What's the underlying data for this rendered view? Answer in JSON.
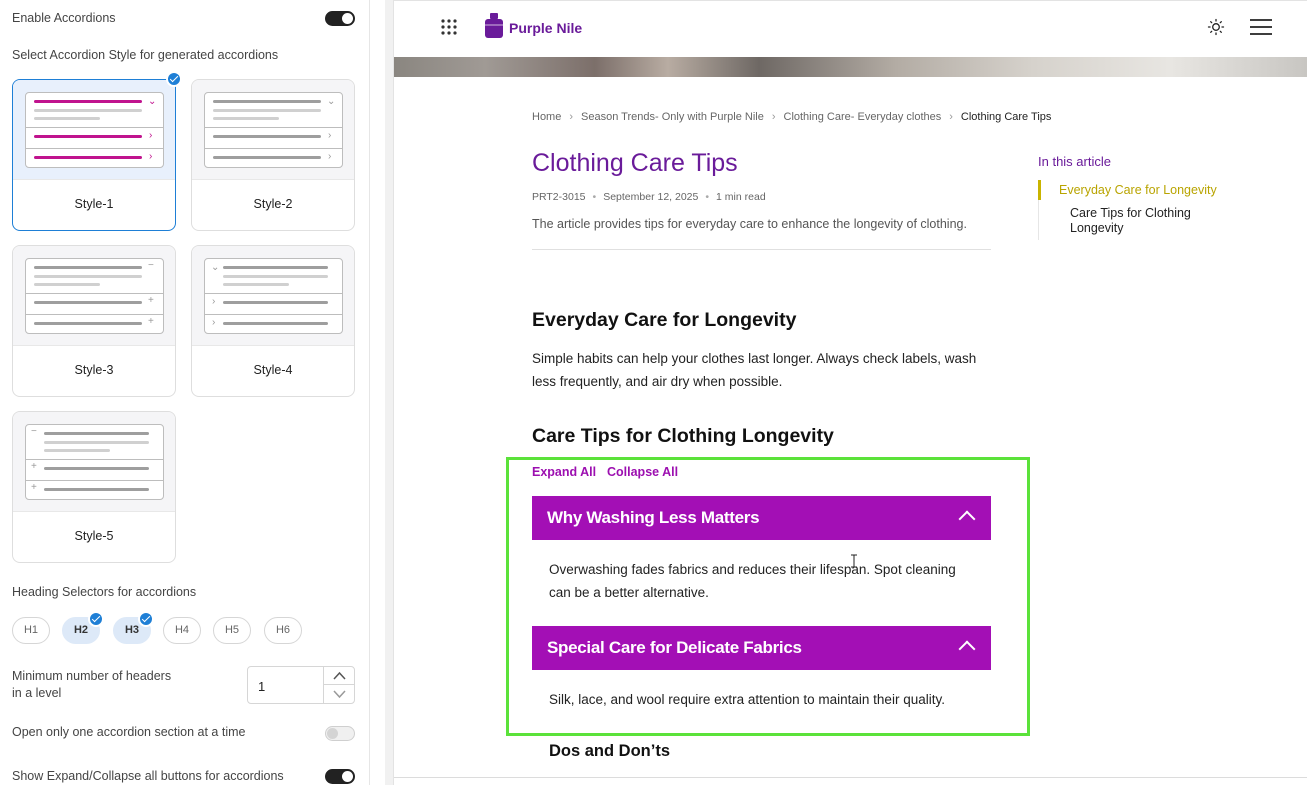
{
  "settings": {
    "enable_accordions_label": "Enable Accordions",
    "select_style_label": "Select Accordion Style for generated accordions",
    "styles": [
      {
        "label": "Style-1",
        "selected": true
      },
      {
        "label": "Style-2",
        "selected": false
      },
      {
        "label": "Style-3",
        "selected": false
      },
      {
        "label": "Style-4",
        "selected": false
      },
      {
        "label": "Style-5",
        "selected": false
      }
    ],
    "heading_selectors_label": "Heading Selectors for accordions",
    "headings": [
      {
        "label": "H1",
        "selected": false
      },
      {
        "label": "H2",
        "selected": true
      },
      {
        "label": "H3",
        "selected": true
      },
      {
        "label": "H4",
        "selected": false
      },
      {
        "label": "H5",
        "selected": false
      },
      {
        "label": "H6",
        "selected": false
      }
    ],
    "min_headers_label_1": "Minimum number of headers",
    "min_headers_label_2": "in a level",
    "min_headers_value": "1",
    "open_one_label": "Open only one accordion section at a time",
    "show_expand_label": "Show Expand/Collapse all buttons for accordions"
  },
  "site": {
    "brand": "Purple Nile",
    "accent_color": "#6a1b9a",
    "accordion_color": "#a30fb5"
  },
  "breadcrumb": [
    "Home",
    "Season Trends- Only with Purple Nile",
    "Clothing Care- Everyday clothes",
    "Clothing Care Tips"
  ],
  "article": {
    "title": "Clothing Care Tips",
    "id": "PRT2-3015",
    "date": "September 12, 2025",
    "read_time": "1 min read",
    "description": "The article provides tips for everyday care to enhance the longevity of clothing.",
    "section1_heading": "Everyday Care for Longevity",
    "section1_text": "Simple habits can help your clothes last longer. Always check labels, wash less frequently, and air dry when possible.",
    "section2_heading": "Care Tips for Clothing Longevity",
    "expand_all": "Expand All",
    "collapse_all": "Collapse All",
    "accordions": [
      {
        "title": "Why Washing Less Matters",
        "body": "Overwashing fades fabrics and reduces their lifespan. Spot cleaning can be a better alternative."
      },
      {
        "title": "Special Care for Delicate Fabrics",
        "body": "Silk, lace, and wool require extra attention to maintain their quality."
      }
    ],
    "next_heading": "Dos and Don’ts"
  },
  "toc": {
    "heading": "In this article",
    "items": [
      "Everyday Care for Longevity",
      "Care Tips for Clothing Longevity"
    ]
  }
}
